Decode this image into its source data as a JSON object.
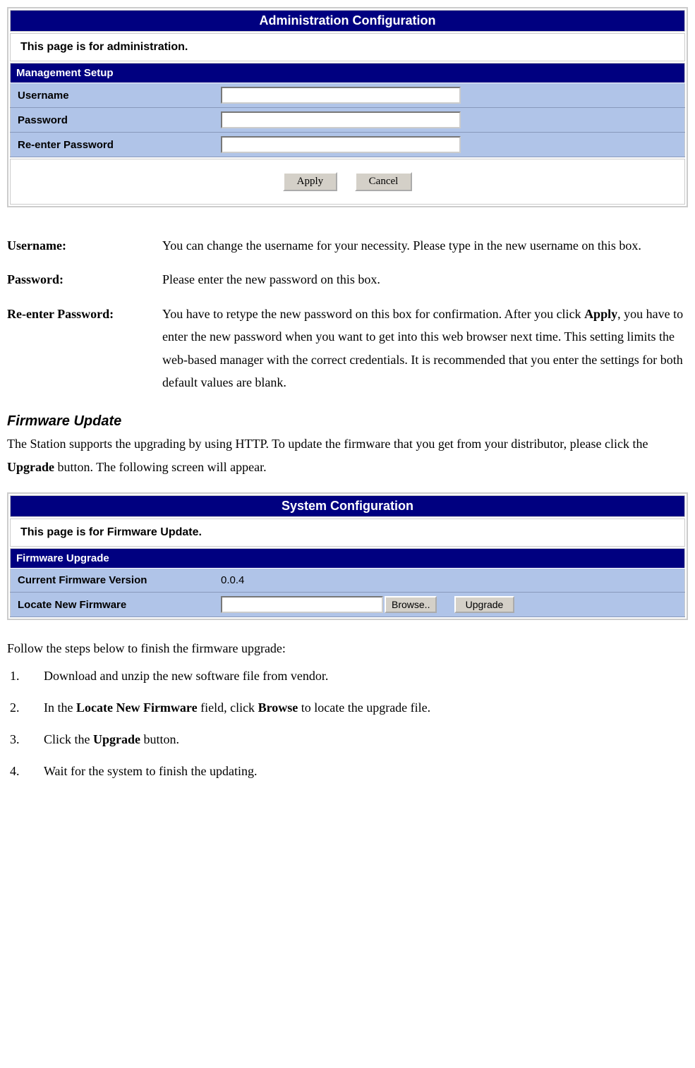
{
  "admin_panel": {
    "title": "Administration Configuration",
    "subtitle": "This page is for administration.",
    "section": "Management Setup",
    "rows": {
      "username_label": "Username",
      "password_label": "Password",
      "reenter_label": "Re-enter Password"
    },
    "buttons": {
      "apply": "Apply",
      "cancel": "Cancel"
    }
  },
  "definitions": {
    "username": {
      "label": "Username:",
      "text": "You can change the username for your necessity. Please type in the new username on this box."
    },
    "password": {
      "label": "Password:",
      "text": "Please enter the new password on this box."
    },
    "reenter": {
      "label": "Re-enter Password:",
      "text_before": "You have to retype the new password on this box for confirmation. After you click ",
      "bold": "Apply",
      "text_after": ", you have to enter the new password when you want to get into this web browser next time. This setting limits the web-based manager with the correct credentials. It is recommended that you enter the settings for both default values are blank."
    }
  },
  "firmware_section": {
    "heading": "Firmware Update",
    "intro_before": "The Station supports the upgrading by using HTTP. To update the firmware that you get from your distributor, please click the ",
    "intro_bold": "Upgrade",
    "intro_after": " button. The following screen will appear."
  },
  "system_panel": {
    "title": "System Configuration",
    "subtitle": "This page is for Firmware Update.",
    "section": "Firmware Upgrade",
    "current_label": "Current Firmware Version",
    "current_value": "0.0.4",
    "locate_label": "Locate New Firmware",
    "browse": "Browse..",
    "upgrade": "Upgrade"
  },
  "steps": {
    "intro": "Follow the steps below to finish the firmware upgrade:",
    "s1": "Download and unzip the new software file from vendor.",
    "s2_before": "In the ",
    "s2_bold1": "Locate New Firmware",
    "s2_mid": " field, click ",
    "s2_bold2": "Browse",
    "s2_after": " to locate the upgrade file.",
    "s3_before": "Click the ",
    "s3_bold": "Upgrade",
    "s3_after": " button.",
    "s4": "Wait for the system to finish the updating."
  }
}
